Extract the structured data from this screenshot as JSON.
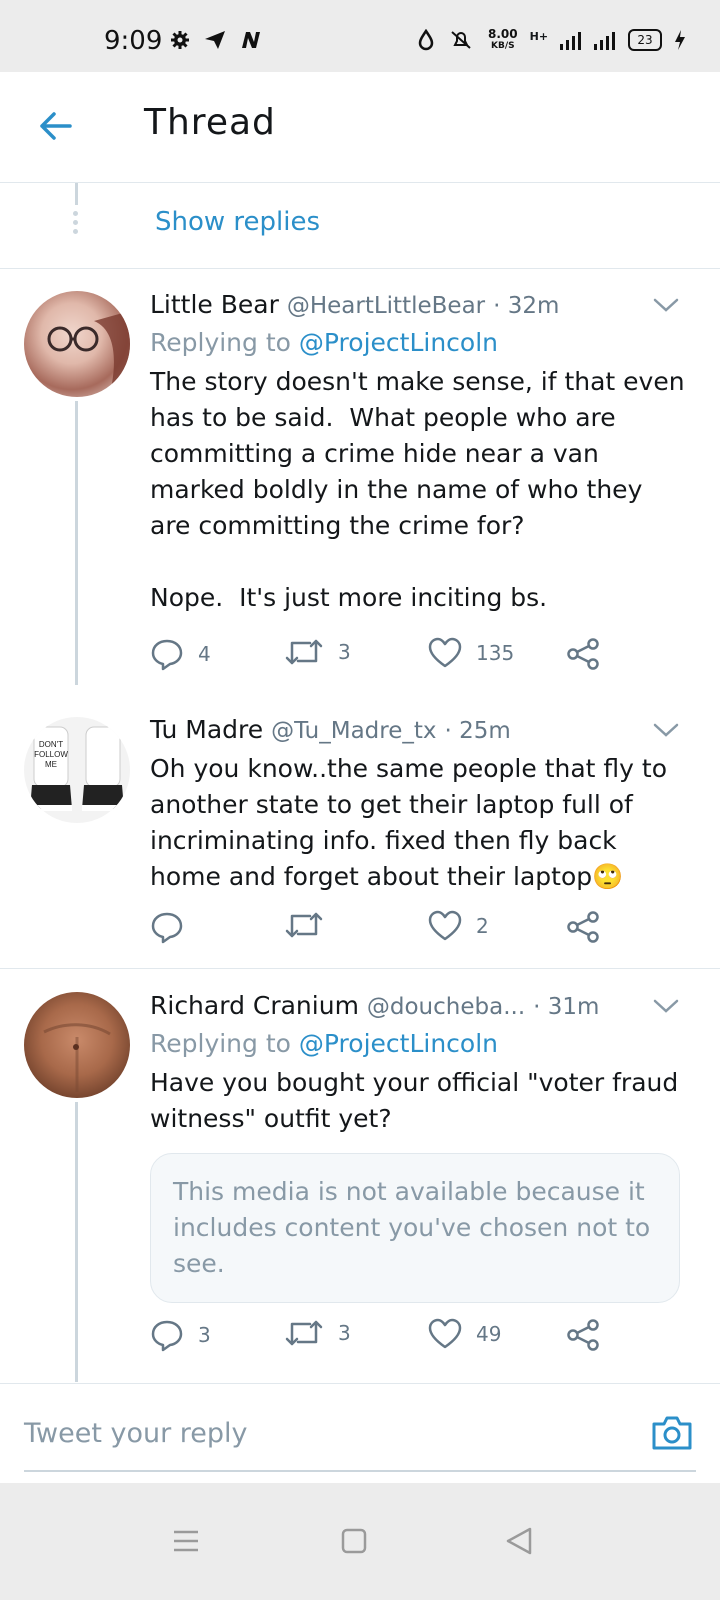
{
  "status_bar": {
    "time": "9:09",
    "speed_value": "8.00",
    "speed_unit": "KB/S",
    "network": "H+",
    "battery": "23",
    "icons": [
      "gear-icon",
      "send-icon",
      "n-icon",
      "water-drop-icon",
      "mute-icon",
      "signal-icon",
      "signal-icon",
      "charging-icon"
    ]
  },
  "header": {
    "title": "Thread",
    "back_icon": "back-arrow-icon"
  },
  "show_replies": "Show replies",
  "tweets": [
    {
      "name": "Little Bear",
      "handle": "@HeartLittleBear",
      "time": "· 32m",
      "replying_prefix": "Replying to",
      "replying_handle": "@ProjectLincoln",
      "text": "The story doesn't make sense, if that even has to be said.  What people who are committing a crime hide near a van marked boldly in the name of who they are committing the crime for?\n\nNope.  It's just more inciting bs.",
      "replies": "4",
      "retweets": "3",
      "likes": "135"
    },
    {
      "name": "Tu Madre",
      "handle": "@Tu_Madre_tx",
      "time": "· 25m",
      "text": "Oh you know..the same people that fly to another state to get their laptop full of incriminating info. fixed then fly back home and forget about their laptop🙄",
      "replies": "",
      "retweets": "",
      "likes": "2",
      "avatar_text": "DON'T FOLLOW ME"
    },
    {
      "name": "Richard Cranium",
      "handle": "@doucheba...",
      "time": "· 31m",
      "replying_prefix": "Replying to",
      "replying_handle": "@ProjectLincoln",
      "text": "Have you bought your official \"voter fraud witness\" outfit yet?",
      "media_notice": "This media is not available because it includes content you've chosen not to see.",
      "replies": "3",
      "retweets": "3",
      "likes": "49"
    }
  ],
  "reply_bar": {
    "placeholder": "Tweet your reply",
    "camera_icon": "camera-icon"
  },
  "nav_bar": {
    "icons": [
      "menu-icon",
      "home-square-icon",
      "back-triangle-icon"
    ]
  },
  "colors": {
    "accent": "#2b8fc9",
    "muted": "#8899a6",
    "divider": "#e1e8ed"
  }
}
